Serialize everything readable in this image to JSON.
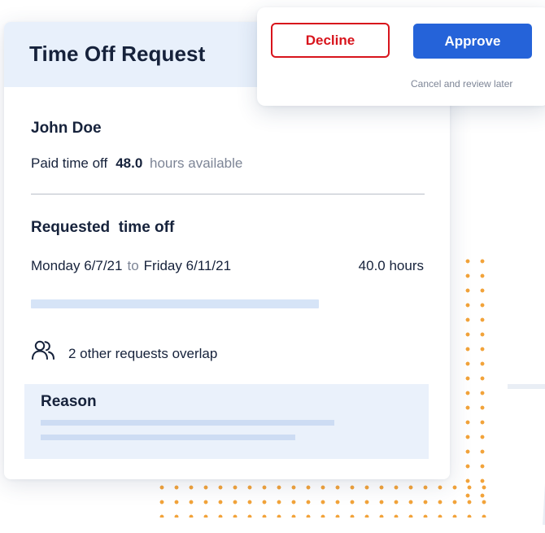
{
  "request": {
    "title": "Time Off Request",
    "employee_name": "John Doe",
    "balance": {
      "label": "Paid time off",
      "hours": "48.0",
      "suffix": "hours available"
    },
    "requested": {
      "heading": "Requested  time off",
      "start": "Monday 6/7/21",
      "to_word": "to",
      "end": "Friday 6/11/21",
      "total": "40.0 hours"
    },
    "overlap": {
      "icon": "users-icon",
      "text": "2 other requests overlap"
    },
    "reason": {
      "title": "Reason"
    }
  },
  "actions": {
    "decline_label": "Decline",
    "approve_label": "Approve",
    "cancel_label": "Cancel and review later"
  },
  "colors": {
    "decline": "#d8141c",
    "approve": "#2563d9",
    "header_bg": "#e8f0fb",
    "accent_dots": "#f2a33a"
  }
}
